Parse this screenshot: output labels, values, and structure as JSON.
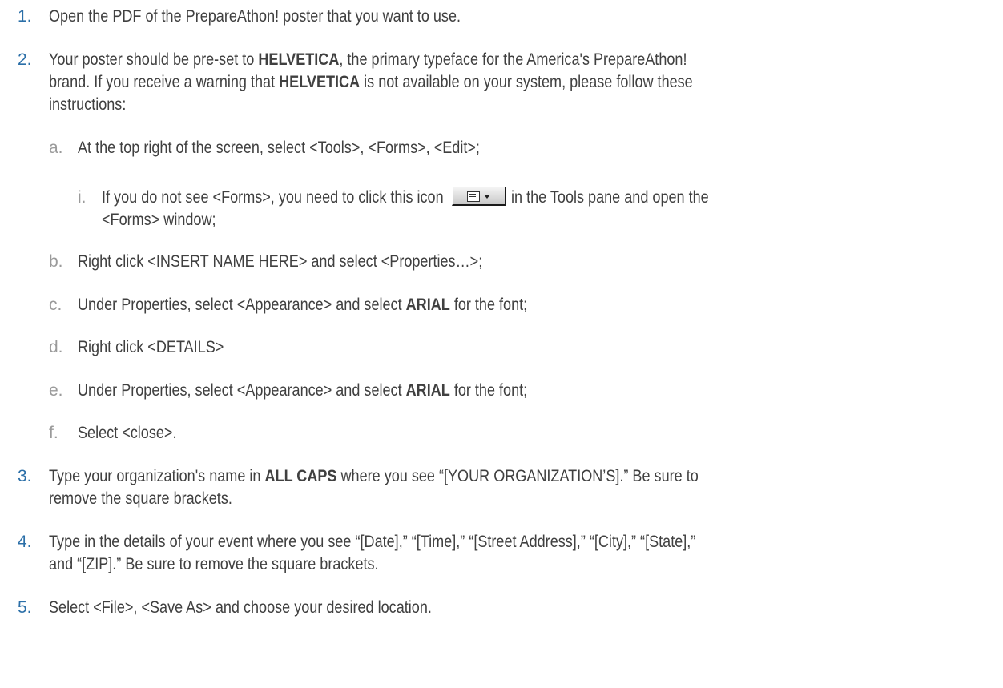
{
  "steps": [
    {
      "number": "1.",
      "lines": [
        {
          "parts": [
            {
              "t": "Open the PDF of the PrepareAthon! poster that you want to use."
            }
          ]
        }
      ]
    },
    {
      "number": "2.",
      "lines": [
        {
          "parts": [
            {
              "t": "Your poster should be pre-set to "
            },
            {
              "t": "HELVETICA",
              "b": true
            },
            {
              "t": ", the primary typeface for the America's PrepareAthon!"
            }
          ]
        },
        {
          "parts": [
            {
              "t": "brand. If you receive a warning that "
            },
            {
              "t": "HELVETICA",
              "b": true
            },
            {
              "t": " is not available on your system, please follow these"
            }
          ]
        },
        {
          "parts": [
            {
              "t": "instructions:"
            }
          ]
        }
      ]
    },
    {
      "number": "3.",
      "lines": [
        {
          "parts": [
            {
              "t": "Type your organization's name in "
            },
            {
              "t": "ALL CAPS",
              "b": true
            },
            {
              "t": " where you see “[YOUR ORGANIZATION’S].” Be sure to"
            }
          ]
        },
        {
          "parts": [
            {
              "t": "remove the square brackets."
            }
          ]
        }
      ]
    },
    {
      "number": "4.",
      "lines": [
        {
          "parts": [
            {
              "t": "Type in the details of your event where you see “[Date],” “[Time],” “[Street Address],” “[City],” “[State],”"
            }
          ]
        },
        {
          "parts": [
            {
              "t": "and “[ZIP].” Be sure to remove the square brackets."
            }
          ]
        }
      ]
    },
    {
      "number": "5.",
      "lines": [
        {
          "parts": [
            {
              "t": "Select <File>, <Save As> and choose your desired location."
            }
          ]
        }
      ]
    }
  ],
  "substeps": [
    {
      "letter": "a.",
      "lines": [
        {
          "parts": [
            {
              "t": "At the top right of the screen, select <Tools>, <Forms>, <Edit>;"
            }
          ]
        }
      ]
    },
    {
      "letter": "i.",
      "lines": [
        {
          "parts": [
            {
              "t": "If you do not see <Forms>, you need to click this icon"
            }
          ]
        },
        {
          "parts": [
            {
              "t": "<Forms> window;"
            }
          ]
        }
      ],
      "after_icon": "in the Tools pane and open the"
    },
    {
      "letter": "b.",
      "lines": [
        {
          "parts": [
            {
              "t": "Right click <INSERT NAME HERE> and select <Properties…>;"
            }
          ]
        }
      ]
    },
    {
      "letter": "c.",
      "lines": [
        {
          "parts": [
            {
              "t": "Under Properties, select <Appearance> and select "
            },
            {
              "t": "ARIAL",
              "b": true
            },
            {
              "t": " for the font;"
            }
          ]
        }
      ]
    },
    {
      "letter": "d.",
      "lines": [
        {
          "parts": [
            {
              "t": "Right click <DETAILS>"
            }
          ]
        }
      ]
    },
    {
      "letter": "e.",
      "lines": [
        {
          "parts": [
            {
              "t": "Under Properties, select <Appearance> and select "
            },
            {
              "t": "ARIAL",
              "b": true
            },
            {
              "t": " for the font;"
            }
          ]
        }
      ]
    },
    {
      "letter": "f.",
      "lines": [
        {
          "parts": [
            {
              "t": "Select <close>."
            }
          ]
        }
      ]
    }
  ],
  "icon": {
    "name": "forms-list-dropdown-icon"
  },
  "colors": {
    "number": "#2b6fa8",
    "sub_letter": "#9a9a9a",
    "text": "#404040"
  }
}
